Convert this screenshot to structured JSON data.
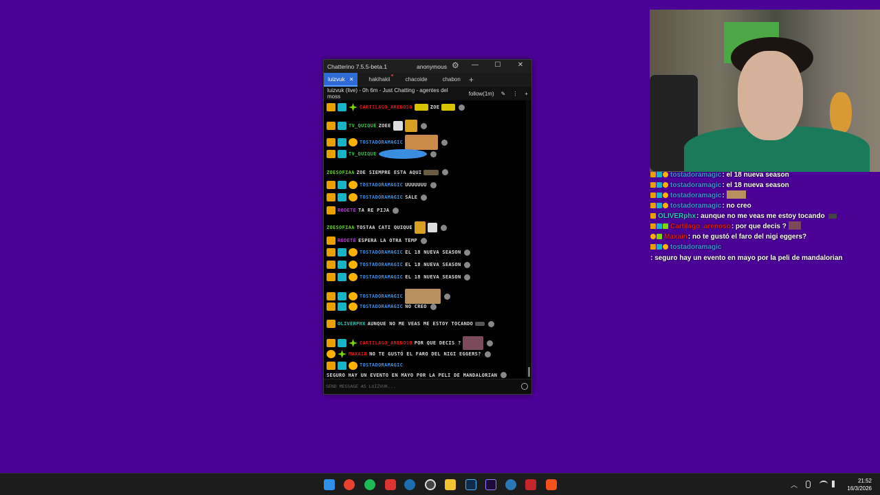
{
  "window": {
    "title": "Chatterino 7.5.5-beta.1",
    "user": "anonymous",
    "minimize": "—",
    "maximize": "☐",
    "close": "✕"
  },
  "tabs": [
    {
      "label": "luizvuk"
    },
    {
      "label": "hakihakii"
    },
    {
      "label": "chacoide"
    },
    {
      "label": "chabon"
    }
  ],
  "tab_close": "✕",
  "tab_add": "+",
  "header": {
    "stream": "luizvuk (live) - 0h 6m - Just Chatting - agentes del moss",
    "follow": "follow(1m)",
    "edit": "✎",
    "menu": "⋮",
    "add": "+"
  },
  "messages": [
    {
      "nick": "CARTILAGO_ARENOSO",
      "color": "#e01818",
      "text": "ZOE"
    },
    {
      "nick": "TV_QUIQUE",
      "color": "#2ec94b",
      "text": "ZOEE"
    },
    {
      "nick": "TOSTADORAMAGIC",
      "color": "#3f8fe0",
      "text": ""
    },
    {
      "nick": "TV_QUIQUE",
      "color": "#2ec94b",
      "text": ""
    },
    {
      "nick": "ZOESOFIAA",
      "color": "#5fd12b",
      "text": "ZOE SIEMPRE ESTA AQUI"
    },
    {
      "nick": "TOSTADORAMAGIC",
      "color": "#3f8fe0",
      "text": "UUUUUUU"
    },
    {
      "nick": "TOSTADORAMAGIC",
      "color": "#3f8fe0",
      "text": "SALE"
    },
    {
      "nick": "RODETE",
      "color": "#b23ed6",
      "text": "TA RE PIJA"
    },
    {
      "nick": "ZOESOFIAA",
      "color": "#5fd12b",
      "text": "TOSTAA CATI QUIQUE"
    },
    {
      "nick": "RODETE",
      "color": "#b23ed6",
      "text": "ESPERA LA OTRA TEMP"
    },
    {
      "nick": "TOSTADORAMAGIC",
      "color": "#3f8fe0",
      "text": "EL 18 NUEVA SEASON"
    },
    {
      "nick": "TOSTADORAMAGIC",
      "color": "#3f8fe0",
      "text": "EL 18 NUEVA SEASON"
    },
    {
      "nick": "TOSTADORAMAGIC",
      "color": "#3f8fe0",
      "text": "EL 18 NUEVA SEASON"
    },
    {
      "nick": "TOSTADORAMAGIC",
      "color": "#3f8fe0",
      "text": ""
    },
    {
      "nick": "TOSTADORAMAGIC",
      "color": "#3f8fe0",
      "text": "NO CREO"
    },
    {
      "nick": "OLIVERPHX",
      "color": "#27c8b8",
      "text": "AUNQUE NO ME VEAS ME ESTOY TOCANDO"
    },
    {
      "nick": "CARTILAGO_ARENOSO",
      "color": "#e01818",
      "text": "POR QUE DECIS ?"
    },
    {
      "nick": "MAXAIN",
      "color": "#e01818",
      "text": "NO TE GUSTÓ EL FARO DEL NIGI EGGERS?"
    },
    {
      "nick": "TOSTADORAMAGIC",
      "color": "#3f8fe0",
      "text": "SEGURO HAY UN EVENTO EN MAYO POR LA PELI DE MANDALORIAN"
    }
  ],
  "input_placeholder": "Send message as luizvuk...",
  "overlay": [
    {
      "nick": "tostadoramagic",
      "color": "#3f8fe0",
      "text": ": el 18 nueva season"
    },
    {
      "nick": "tostadoramagic",
      "color": "#3f8fe0",
      "text": ": el 18 nueva season"
    },
    {
      "nick": "tostadoramagic",
      "color": "#3f8fe0",
      "text": ":"
    },
    {
      "nick": "tostadoramagic",
      "color": "#3f8fe0",
      "text": ": no creo"
    },
    {
      "nick": "OLIVERphx",
      "color": "#27c8b8",
      "text": ": aunque no me veas me estoy tocando"
    },
    {
      "nick": "Cartilago_arenoso",
      "color": "#e01818",
      "text": ": por que decis ?"
    },
    {
      "nick": "Maxain",
      "color": "#e01818",
      "text": ": no te gustó el faro del nigi eggers?"
    },
    {
      "nick": "tostadoramagic",
      "color": "#3f8fe0",
      "text": ": seguro hay un evento en mayo por la peli de mandalorian"
    }
  ],
  "taskbar": {
    "icons": [
      "windows-start",
      "chrome",
      "spotify",
      "app-red",
      "steam",
      "obs",
      "file-explorer",
      "photoshop",
      "premiere",
      "ccleaner",
      "vmix",
      "brave"
    ],
    "tray_chevron": "︿",
    "time": "21:52",
    "date": "16/3/2026"
  },
  "colors": {
    "background": "#4b0096",
    "accent_tab": "#2e6bd6"
  }
}
